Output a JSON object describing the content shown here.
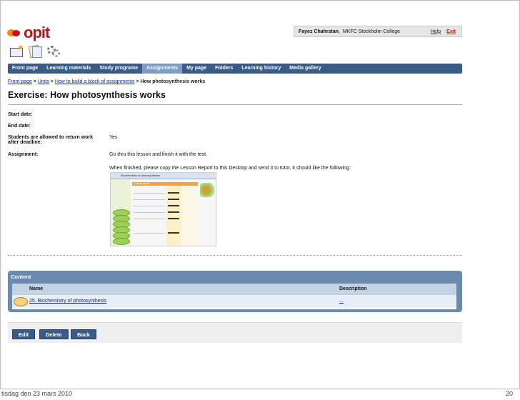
{
  "app": {
    "logo_text": "opit"
  },
  "header": {
    "icons": [
      "mail-icon",
      "documents-icon",
      "settings-gear-icon"
    ],
    "user_name": "Fayez Chahrstan",
    "user_org": "MKFC Stockholm College",
    "help_label": "Help",
    "exit_label": "Exit"
  },
  "nav": {
    "items": [
      {
        "label": "Front page",
        "active": false
      },
      {
        "label": "Learning materials",
        "active": false
      },
      {
        "label": "Study programe",
        "active": false
      },
      {
        "label": "Assignments",
        "active": true
      },
      {
        "label": "My page",
        "active": false
      },
      {
        "label": "Folders",
        "active": false
      },
      {
        "label": "Learning history",
        "active": false
      },
      {
        "label": "Media gallery",
        "active": false
      }
    ]
  },
  "breadcrumb": {
    "items": [
      "Front page",
      "Units",
      "How to build a block of assignments"
    ],
    "current": "How photosynthesis works",
    "separator": ">"
  },
  "page": {
    "title": "Exercise: How photosynthesis works",
    "fields": {
      "start_date_label": "Start date:",
      "start_date_value": "",
      "end_date_label": "End date:",
      "end_date_value": "",
      "late_label_line1": "Students are allowed to return work",
      "late_label_line2": "after deadline:",
      "late_value": "Yes",
      "assignment_label": "Assignment:",
      "assignment_text1": "Go thru this lesson and finish it with the test.",
      "assignment_text2": "When finished, please copy the Lesson Report to this Desktop and send it to tutor, it should like the following:"
    },
    "report_image": {
      "title": "Biochemistry of photosynthesis",
      "header": "Lesson report"
    }
  },
  "content": {
    "heading": "Content",
    "columns": [
      "Name",
      "Description"
    ],
    "rows": [
      {
        "name": "25. Biochemistry of photosynthesis",
        "description": "..."
      }
    ]
  },
  "buttons": {
    "edit": "Edit",
    "delete": "Delete",
    "back": "Back"
  },
  "footer": {
    "date": "tisdag den 23 mars 2010",
    "page": "20"
  },
  "colors": {
    "nav": "#385b88",
    "nav_active": "#7e9cc4",
    "content_panel": "#6b8ab0",
    "logo_red": "#b01a1a"
  }
}
